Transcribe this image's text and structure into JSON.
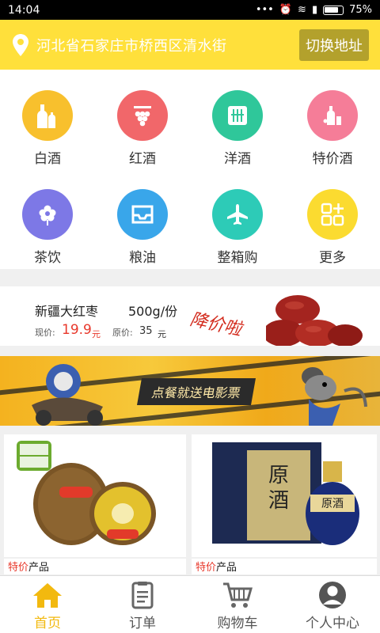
{
  "status_bar": {
    "time": "14:04",
    "battery": "75%"
  },
  "header": {
    "address": "河北省石家庄市桥西区清水街",
    "switch_label": "切换地址",
    "accent": "#ffe03b"
  },
  "categories": [
    {
      "label": "白酒",
      "icon": "bottles-icon",
      "color": "#f8c02d"
    },
    {
      "label": "红酒",
      "icon": "grapes-icon",
      "color": "#f1676a"
    },
    {
      "label": "洋酒",
      "icon": "foreign-wine-icon",
      "color": "#2fc79a"
    },
    {
      "label": "特价酒",
      "icon": "discount-wine-icon",
      "color": "#f57d98"
    },
    {
      "label": "茶饮",
      "icon": "flower-icon",
      "color": "#7d78e6"
    },
    {
      "label": "粮油",
      "icon": "tray-icon",
      "color": "#39a6ea"
    },
    {
      "label": "整箱购",
      "icon": "airplane-icon",
      "color": "#2dcbb7"
    },
    {
      "label": "更多",
      "icon": "more-grid-icon",
      "color": "#fbdb30"
    }
  ],
  "promo": {
    "name": "新疆大红枣",
    "weight": "500g/份",
    "now_label": "现价:",
    "now_price": "19.9",
    "unit": "元",
    "orig_label": "原价:",
    "orig_price": "35",
    "slogan": "降价啦"
  },
  "movie_banner": {
    "text": "点餐就送电影票"
  },
  "products": [
    {
      "tag_hl": "特价",
      "tag_rest": "产品"
    },
    {
      "tag_hl": "特价",
      "tag_rest": "产品"
    }
  ],
  "nav": [
    {
      "label": "首页",
      "icon": "home-icon",
      "active": true
    },
    {
      "label": "订单",
      "icon": "orders-icon",
      "active": false
    },
    {
      "label": "购物车",
      "icon": "cart-icon",
      "active": false
    },
    {
      "label": "个人中心",
      "icon": "user-icon",
      "active": false
    }
  ]
}
